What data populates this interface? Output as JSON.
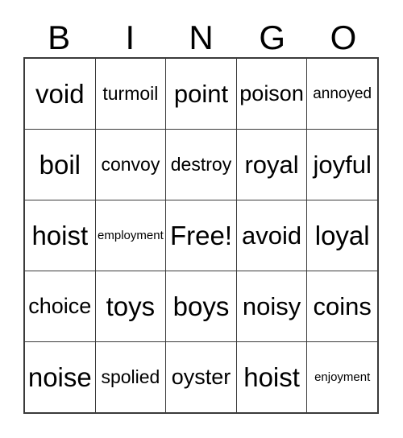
{
  "card": {
    "header_letters": [
      "B",
      "I",
      "N",
      "G",
      "O"
    ],
    "rows": [
      [
        {
          "text": "void",
          "size": "fs-xxl"
        },
        {
          "text": "turmoil",
          "size": "fs-m"
        },
        {
          "text": "point",
          "size": "fs-xl"
        },
        {
          "text": "poison",
          "size": "fs-l"
        },
        {
          "text": "annoyed",
          "size": "fs-s"
        }
      ],
      [
        {
          "text": "boil",
          "size": "fs-xxl"
        },
        {
          "text": "convoy",
          "size": "fs-m"
        },
        {
          "text": "destroy",
          "size": "fs-m"
        },
        {
          "text": "royal",
          "size": "fs-xl"
        },
        {
          "text": "joyful",
          "size": "fs-xl"
        }
      ],
      [
        {
          "text": "hoist",
          "size": "fs-xxl"
        },
        {
          "text": "employment",
          "size": "fs-xs"
        },
        {
          "text": "Free!",
          "size": "fs-xxl"
        },
        {
          "text": "avoid",
          "size": "fs-xl"
        },
        {
          "text": "loyal",
          "size": "fs-xxl"
        }
      ],
      [
        {
          "text": "choice",
          "size": "fs-l"
        },
        {
          "text": "toys",
          "size": "fs-xxl"
        },
        {
          "text": "boys",
          "size": "fs-xxl"
        },
        {
          "text": "noisy",
          "size": "fs-xl"
        },
        {
          "text": "coins",
          "size": "fs-xl"
        }
      ],
      [
        {
          "text": "noise",
          "size": "fs-xxl"
        },
        {
          "text": "spolied",
          "size": "fs-m"
        },
        {
          "text": "oyster",
          "size": "fs-l"
        },
        {
          "text": "hoist",
          "size": "fs-xxl"
        },
        {
          "text": "enjoyment",
          "size": "fs-xs"
        }
      ]
    ]
  },
  "colors": {
    "text": "#000000",
    "border": "#3a3a3a",
    "background": "#ffffff"
  }
}
